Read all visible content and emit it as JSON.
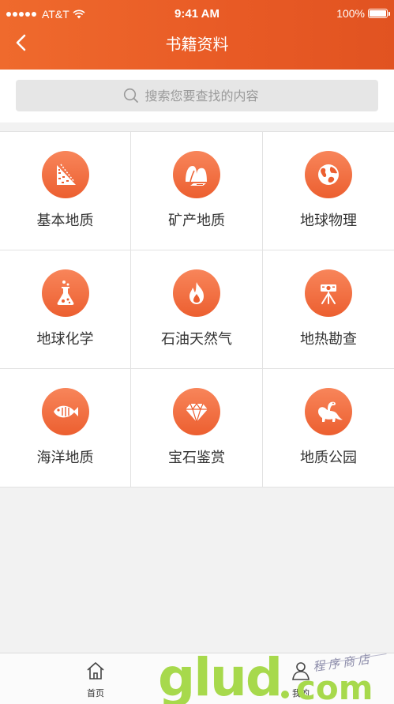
{
  "status_bar": {
    "carrier": "AT&T",
    "time": "9:41 AM",
    "battery": "100%",
    "battery_level": 1.0
  },
  "nav": {
    "title": "书籍资料",
    "back_icon": "chevron-left-icon"
  },
  "search": {
    "placeholder": "搜索您要查找的内容",
    "value": "",
    "icon": "search-icon"
  },
  "categories": [
    {
      "label": "基本地质",
      "icon": "rock-strata-icon"
    },
    {
      "label": "矿产地质",
      "icon": "mineral-mountain-icon"
    },
    {
      "label": "地球物理",
      "icon": "globe-icon"
    },
    {
      "label": "地球化学",
      "icon": "flask-icon"
    },
    {
      "label": "石油天然气",
      "icon": "flame-icon"
    },
    {
      "label": "地热勘查",
      "icon": "survey-instrument-icon"
    },
    {
      "label": "海洋地质",
      "icon": "fish-icon"
    },
    {
      "label": "宝石鉴赏",
      "icon": "diamond-icon"
    },
    {
      "label": "地质公园",
      "icon": "dinosaur-icon"
    }
  ],
  "tabbar": {
    "home_label": "首页",
    "home_icon": "home-icon",
    "mine_label": "我的",
    "mine_icon": "user-icon"
  },
  "watermark": {
    "main": "glud",
    "suffix": "com",
    "tagline": "程序商店"
  },
  "colors": {
    "accent": "#e85a25",
    "icon_gradient_top": "#f8855a",
    "icon_gradient_bottom": "#ec5f30",
    "watermark": "#a7d94c"
  }
}
